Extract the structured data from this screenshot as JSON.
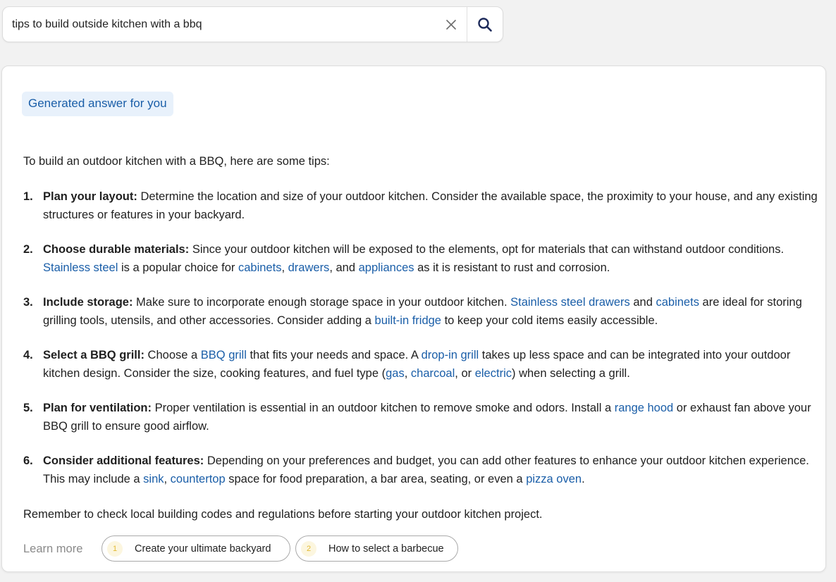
{
  "search": {
    "value": "tips to build outside kitchen with a bbq",
    "clear_icon": "close-icon",
    "search_icon": "search-icon"
  },
  "answer": {
    "badge": "Generated answer for you",
    "intro": "To build an outdoor kitchen with a BBQ, here are some tips:",
    "tips": [
      {
        "num": "1.",
        "title": "Plan your layout:",
        "segments": [
          {
            "t": " Determine the location and size of your outdoor kitchen. Consider the available space, the proximity to your house, and any existing structures or features in your backyard."
          }
        ]
      },
      {
        "num": "2.",
        "title": "Choose durable materials:",
        "segments": [
          {
            "t": " Since your outdoor kitchen will be exposed to the elements, opt for materials that can withstand outdoor conditions. "
          },
          {
            "t": "Stainless steel",
            "link": true
          },
          {
            "t": " is a popular choice for "
          },
          {
            "t": "cabinets",
            "link": true
          },
          {
            "t": ", "
          },
          {
            "t": "drawers",
            "link": true
          },
          {
            "t": ", and "
          },
          {
            "t": "appliances",
            "link": true
          },
          {
            "t": " as it is resistant to rust and corrosion."
          }
        ]
      },
      {
        "num": "3.",
        "title": "Include storage:",
        "segments": [
          {
            "t": " Make sure to incorporate enough storage space in your outdoor kitchen. "
          },
          {
            "t": "Stainless steel drawers",
            "link": true
          },
          {
            "t": " and "
          },
          {
            "t": "cabinets",
            "link": true
          },
          {
            "t": " are ideal for storing grilling tools, utensils, and other accessories. Consider adding a "
          },
          {
            "t": "built-in fridge",
            "link": true
          },
          {
            "t": " to keep your cold items easily accessible."
          }
        ]
      },
      {
        "num": "4.",
        "title": "Select a BBQ grill:",
        "segments": [
          {
            "t": " Choose a "
          },
          {
            "t": "BBQ grill",
            "link": true
          },
          {
            "t": " that fits your needs and space. A "
          },
          {
            "t": "drop-in grill",
            "link": true
          },
          {
            "t": " takes up less space and can be integrated into your outdoor kitchen design. Consider the size, cooking features, and fuel type ("
          },
          {
            "t": "gas",
            "link": true
          },
          {
            "t": ", "
          },
          {
            "t": "charcoal",
            "link": true
          },
          {
            "t": ", or "
          },
          {
            "t": "electric",
            "link": true
          },
          {
            "t": ") when selecting a grill."
          }
        ]
      },
      {
        "num": "5.",
        "title": "Plan for ventilation:",
        "segments": [
          {
            "t": " Proper ventilation is essential in an outdoor kitchen to remove smoke and odors. Install a "
          },
          {
            "t": "range hood",
            "link": true
          },
          {
            "t": " or exhaust fan above your BBQ grill to ensure good airflow."
          }
        ]
      },
      {
        "num": "6.",
        "title": "Consider additional features:",
        "segments": [
          {
            "t": " Depending on your preferences and budget, you can add other features to enhance your outdoor kitchen experience. This may include a "
          },
          {
            "t": "sink",
            "link": true
          },
          {
            "t": ", "
          },
          {
            "t": "countertop",
            "link": true
          },
          {
            "t": " space for food preparation, a bar area, seating, or even a "
          },
          {
            "t": "pizza oven",
            "link": true
          },
          {
            "t": "."
          }
        ]
      }
    ],
    "closing": "Remember to check local building codes and regulations before starting your outdoor kitchen project.",
    "learn_more": {
      "label": "Learn more",
      "links": [
        {
          "num": "1",
          "label": "Create your ultimate backyard"
        },
        {
          "num": "2",
          "label": "How to select a barbecue"
        }
      ]
    }
  },
  "colors": {
    "link": "#1a5ea8",
    "badge_bg": "#e8f1fb",
    "chip_number": "#e2b932",
    "background": "#f2f2f2"
  }
}
